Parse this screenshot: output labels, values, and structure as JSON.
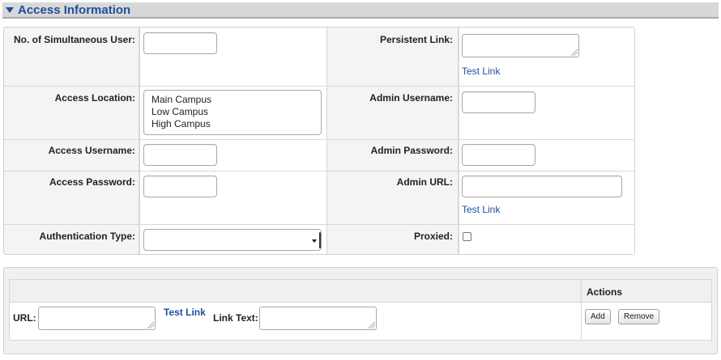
{
  "section": {
    "title": "Access Information"
  },
  "fields": {
    "simultaneous_users": {
      "label": "No. of Simultaneous User:",
      "value": ""
    },
    "persistent_link": {
      "label": "Persistent Link:",
      "value": "",
      "test_link": "Test Link"
    },
    "access_location": {
      "label": "Access Location:",
      "options": [
        "Main Campus",
        "Low Campus",
        "High Campus"
      ]
    },
    "admin_username": {
      "label": "Admin Username:",
      "value": ""
    },
    "access_username": {
      "label": "Access Username:",
      "value": ""
    },
    "admin_password": {
      "label": "Admin Password:",
      "value": ""
    },
    "access_password": {
      "label": "Access Password:",
      "value": ""
    },
    "admin_url": {
      "label": "Admin URL:",
      "value": "",
      "test_link": "Test Link"
    },
    "authentication_type": {
      "label": "Authentication Type:",
      "selected": ""
    },
    "proxied": {
      "label": "Proxied:",
      "checked": false
    }
  },
  "url_section": {
    "actions_header": "Actions",
    "url_label": "URL:",
    "url_value": "",
    "test_link": "Test Link",
    "link_text_label": "Link Text:",
    "link_text_value": "",
    "add_button": "Add",
    "remove_button": "Remove"
  }
}
